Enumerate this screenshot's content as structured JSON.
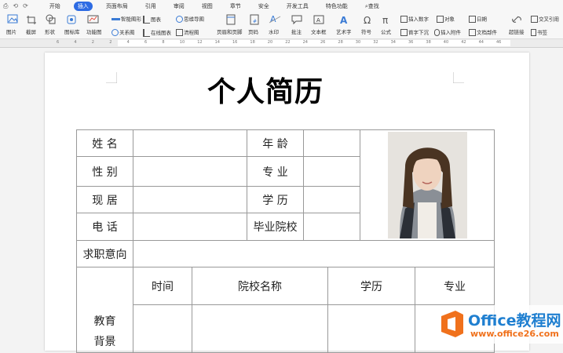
{
  "menu": {
    "quick_access": [
      "⎙",
      "⟲",
      "⟳"
    ],
    "tabs": [
      "开始",
      "插入",
      "页面布局",
      "引用",
      "审阅",
      "视图",
      "章节",
      "安全",
      "开发工具",
      "特色功能"
    ],
    "active_tab": "插入",
    "search_label": "查找"
  },
  "ribbon": {
    "row1": [
      "智能图形",
      "图表",
      "思维导图",
      "插入数字",
      "对象",
      "日期",
      "交叉引用"
    ],
    "row2": [
      "图片",
      "截屏",
      "形状",
      "图标库",
      "功能图",
      "关系图",
      "在线图表",
      "流程图",
      "页眉和页脚",
      "页码",
      "水印",
      "批注",
      "文本框",
      "艺术字",
      "符号",
      "公式",
      "首字下沉",
      "插入附件",
      "文档部件",
      "超链接",
      "书签"
    ]
  },
  "ruler": {
    "ticks": [
      "6",
      "4",
      "2",
      "2",
      "4",
      "6",
      "8",
      "10",
      "12",
      "14",
      "16",
      "18",
      "20",
      "22",
      "24",
      "26",
      "28",
      "30",
      "32",
      "34",
      "36",
      "38",
      "40",
      "42",
      "44",
      "46"
    ]
  },
  "document": {
    "title": "个人简历",
    "labels": {
      "name": "姓  名",
      "age": "年  龄",
      "gender": "性  别",
      "major": "专  业",
      "residence": "现  居",
      "degree": "学  历",
      "phone": "电  话",
      "school": "毕业院校",
      "objective": "求职意向",
      "education_line1": "教育",
      "education_line2": "背景"
    },
    "education_headers": [
      "时间",
      "院校名称",
      "学历",
      "专业"
    ]
  },
  "watermark": {
    "brand": "Office教程网",
    "url": "www.office26.com"
  },
  "colors": {
    "active_tab": "#2d6be3",
    "logo_orange": "#f0711c",
    "logo_blue": "#1f7fd0"
  }
}
